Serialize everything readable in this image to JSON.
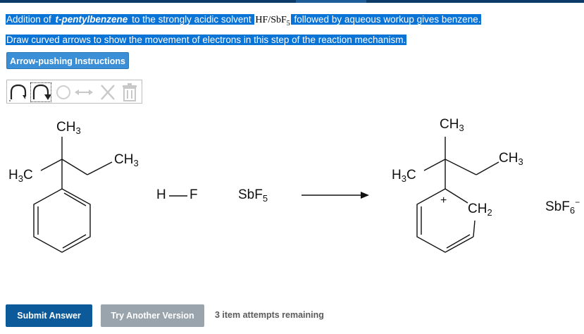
{
  "header": {
    "line1": {
      "part1": "Addition of ",
      "compound": "t-pentylbenzene",
      "part2": " to the strongly acidic solvent ",
      "acid": "HF",
      "slash": "/",
      "lewis": "SbF",
      "lewis_sub": "5",
      "part3": " followed by aqueous workup gives benzene."
    },
    "line2": "Draw curved arrows to show the movement of electrons in this step of the reaction mechanism.",
    "instructions_button": "Arrow-pushing Instructions"
  },
  "toolbar": {
    "tools": [
      {
        "name": "single-electron-arrow-icon"
      },
      {
        "name": "electron-pair-arrow-icon"
      },
      {
        "name": "ring-selection-icon"
      },
      {
        "name": "double-arrow-icon"
      },
      {
        "name": "delete-x-icon"
      },
      {
        "name": "trash-icon"
      }
    ]
  },
  "reactant": {
    "ch3_top": "CH",
    "ch3_top_sub": "3",
    "ch3_right": "CH",
    "ch3_right_sub": "3",
    "h3c_left_h": "H",
    "h3c_left_sub": "3",
    "h3c_left_c": "C"
  },
  "reagents": {
    "hf_h": "H",
    "hf_f": "F",
    "sbf5": "SbF",
    "sbf5_sub": "5"
  },
  "product": {
    "ch3_top": "CH",
    "ch3_top_sub": "3",
    "ch3_right": "CH",
    "ch3_right_sub": "3",
    "h3c_left_h": "H",
    "h3c_left_sub": "3",
    "h3c_left_c": "C",
    "ch2": "CH",
    "ch2_sub": "2",
    "charge": "+",
    "sbf6": "SbF",
    "sbf6_sub": "6",
    "sbf6_charge": "−"
  },
  "footer": {
    "submit": "Submit Answer",
    "another": "Try Another Version",
    "attempts": "3 item attempts remaining"
  },
  "colors": {
    "highlight": "#0a73d6",
    "submit_bg": "#0d5a9a",
    "another_bg": "#9aa4ad",
    "instr_bg": "#3b8fd6"
  }
}
